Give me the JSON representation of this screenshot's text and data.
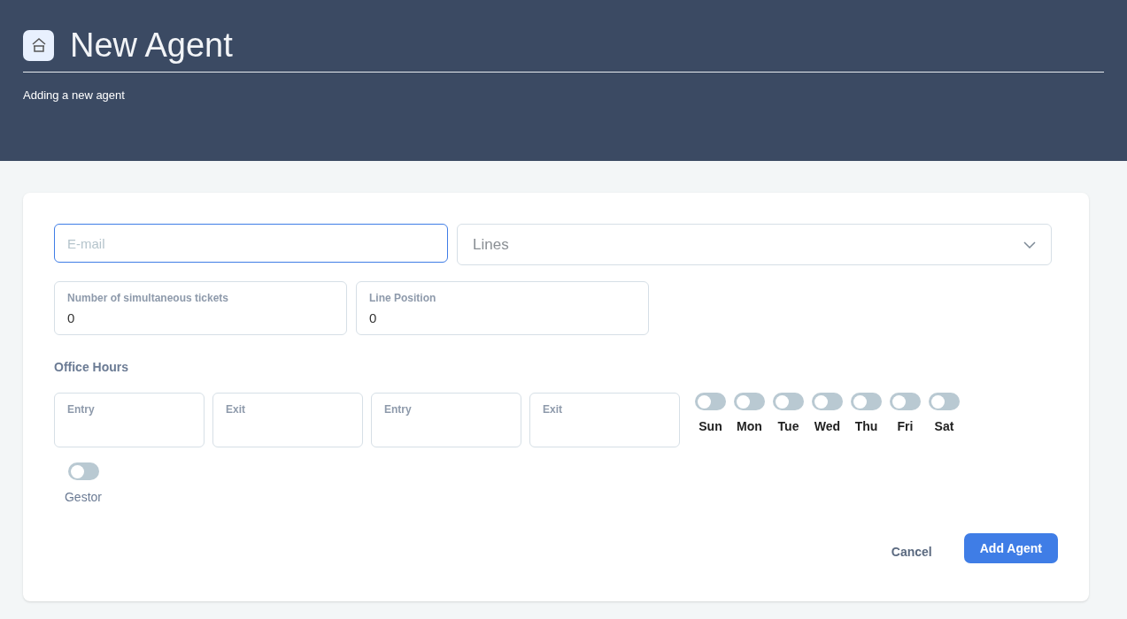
{
  "header": {
    "title": "New Agent",
    "subtitle": "Adding a new agent"
  },
  "form": {
    "email": {
      "placeholder": "E-mail",
      "focused": true
    },
    "lines": {
      "placeholder": "Lines"
    },
    "number_fields": [
      {
        "label": "Number of simultaneous tickets",
        "value": "0"
      },
      {
        "label": "Line Position",
        "value": "0"
      }
    ],
    "office_hours": {
      "title": "Office Hours",
      "times": [
        {
          "label": "Entry"
        },
        {
          "label": "Exit"
        },
        {
          "label": "Entry"
        },
        {
          "label": "Exit"
        }
      ],
      "days": [
        {
          "label": "Sun",
          "on": false
        },
        {
          "label": "Mon",
          "on": false
        },
        {
          "label": "Tue",
          "on": false
        },
        {
          "label": "Wed",
          "on": false
        },
        {
          "label": "Thu",
          "on": false
        },
        {
          "label": "Fri",
          "on": false
        },
        {
          "label": "Sat",
          "on": false
        }
      ]
    },
    "gestor": {
      "label": "Gestor",
      "on": false
    }
  },
  "buttons": {
    "cancel": "Cancel",
    "submit": "Add Agent"
  }
}
